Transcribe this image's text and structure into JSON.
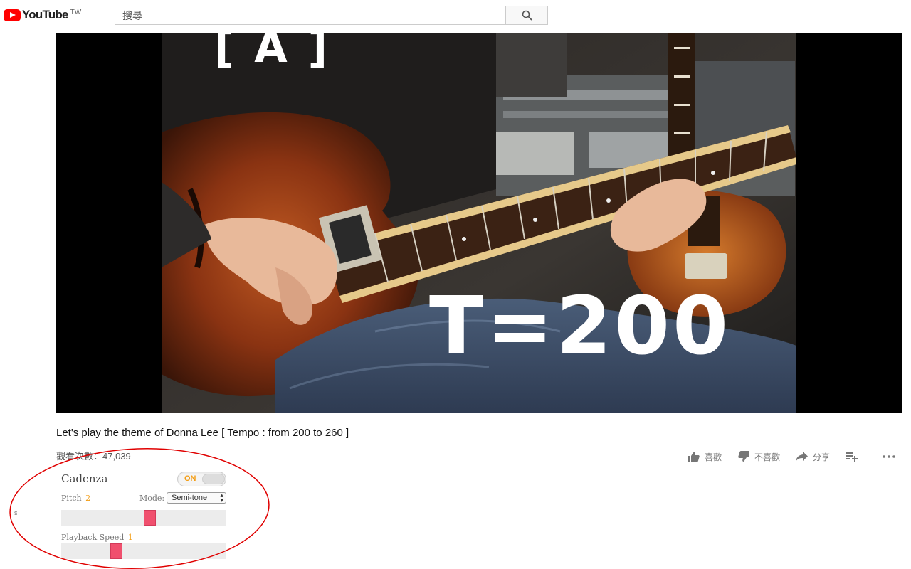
{
  "masthead": {
    "logo_text": "YouTube",
    "logo_country": "TW",
    "search_placeholder": "搜尋",
    "search_icon": "search-icon"
  },
  "player": {
    "overlay_section": "[ A ]",
    "overlay_tempo": "T=200"
  },
  "video": {
    "title": "Let's play the theme of Donna Lee [ Tempo : from 200 to 260 ]",
    "views": "觀看次數：47,039",
    "actions": [
      {
        "icon": "thumbs-up-icon",
        "label": "喜歡"
      },
      {
        "icon": "thumbs-down-icon",
        "label": "不喜歡"
      },
      {
        "icon": "share-icon",
        "label": "分享"
      },
      {
        "icon": "add-to-playlist-icon",
        "label": ""
      },
      {
        "icon": "more-icon",
        "label": ""
      }
    ]
  },
  "cadenza": {
    "title": "Cadenza",
    "toggle_label": "ON",
    "toggle_on": true,
    "pitch_label": "Pitch",
    "pitch_value": "2",
    "mode_label": "Mode:",
    "mode_value": "Semi-tone",
    "pitch_level": 0.54,
    "speed_label": "Playback Speed",
    "speed_value": "1",
    "speed_level": 0.32,
    "accent_color": "#f39c12",
    "handle_color": "#f0506e"
  },
  "stray_text": "s",
  "annotation_color": "#e00000"
}
